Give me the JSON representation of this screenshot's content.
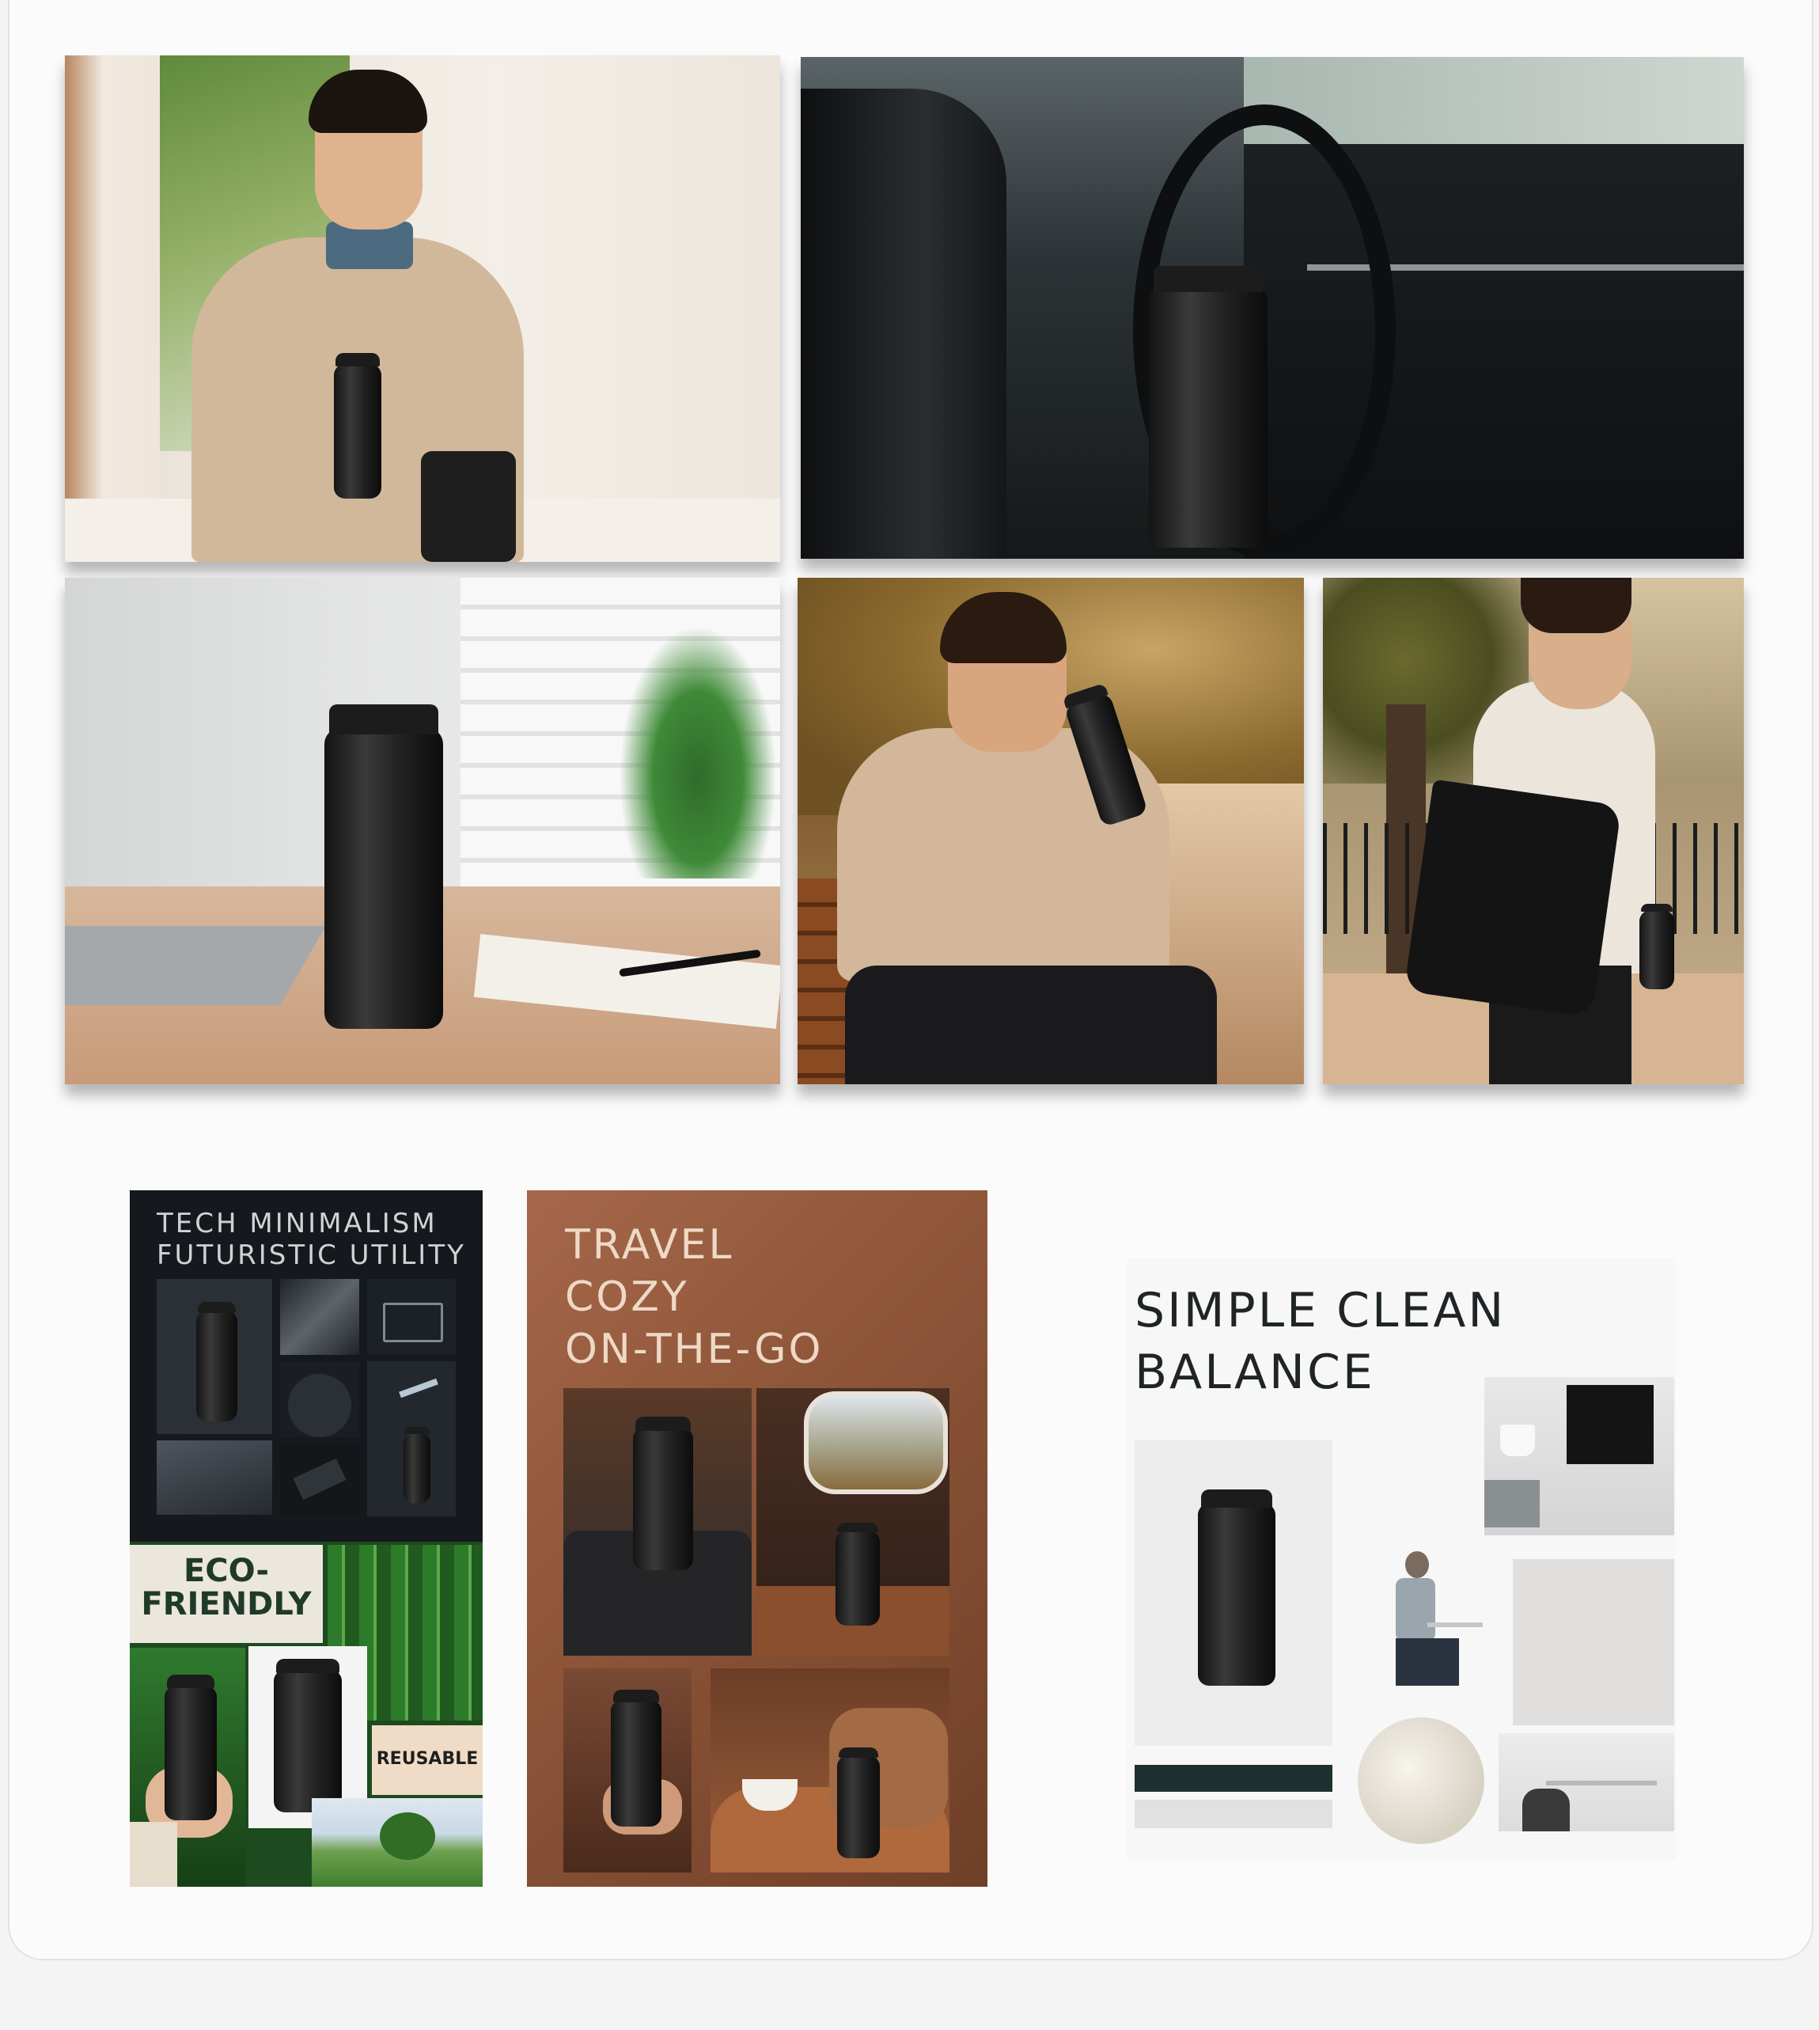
{
  "gallery": {
    "photos": [
      {
        "label": "man-holding-bottle-doorway"
      },
      {
        "label": "bottle-in-car-cupholder"
      },
      {
        "label": "bottle-on-desk-with-laptop"
      },
      {
        "label": "man-drinking-on-bench"
      },
      {
        "label": "man-walking-with-bag"
      }
    ]
  },
  "moodboards": {
    "tech": {
      "line1": "TECH MINIMALISM",
      "line2": "FUTURISTIC UTILITY",
      "eco_title": "ECO-\nFRIENDLY",
      "reusable": "REUSABLE"
    },
    "travel": {
      "line1": "TRAVEL",
      "line2": "COZY",
      "line3": "ON-THE-GO"
    },
    "simple": {
      "line1": "SIMPLE  CLEAN",
      "line2": "BALANCE"
    }
  },
  "colors": {
    "tech_bg": "#15181c",
    "eco_green": "#1d4a1e",
    "travel_brown": "#8a5236",
    "simple_bg": "#f7f7f7"
  }
}
